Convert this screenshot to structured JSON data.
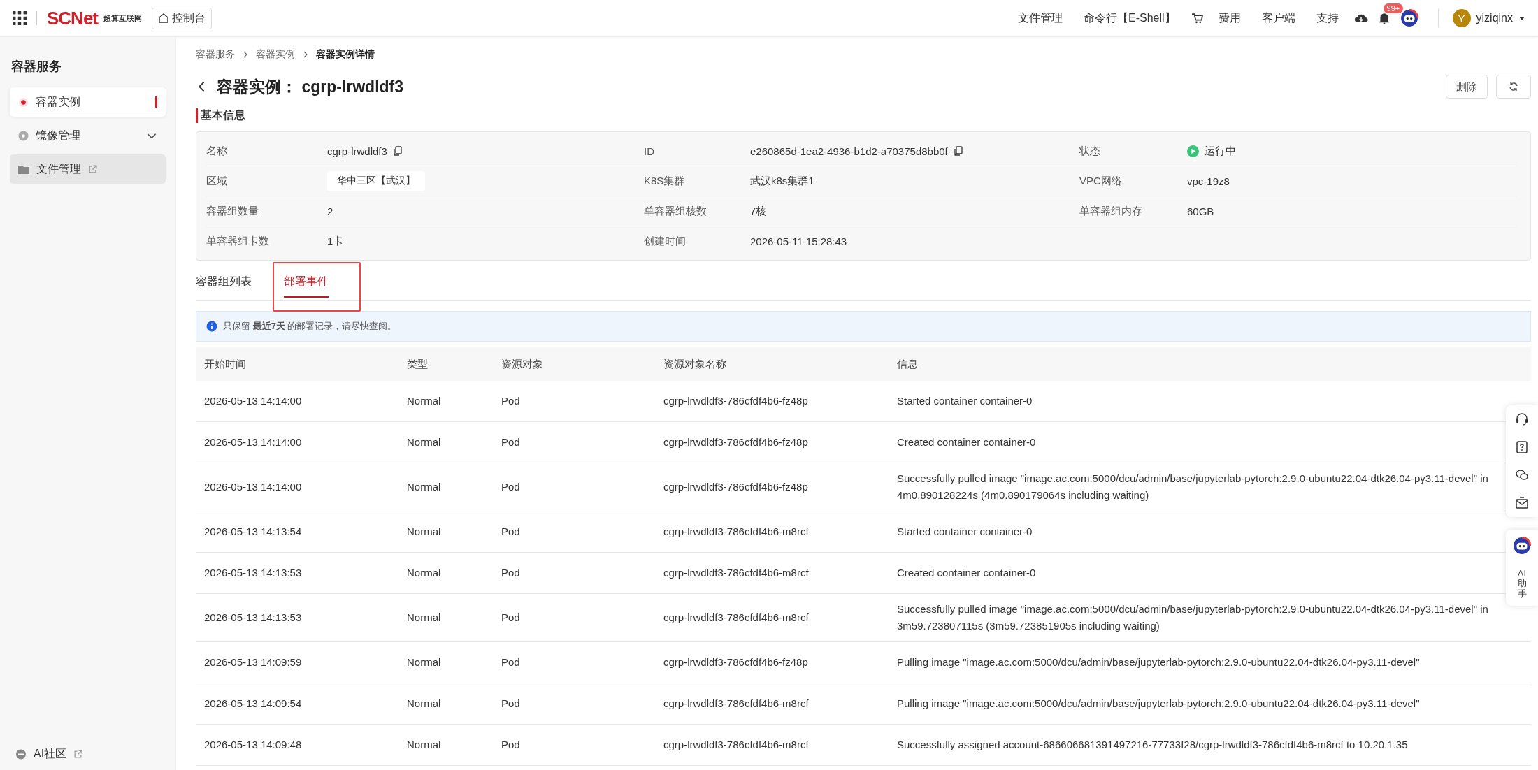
{
  "topbar": {
    "logo": "SCNet",
    "logo_sub": "超算互联网",
    "console": "控制台",
    "links": [
      {
        "kind": "text",
        "label": "文件管理"
      },
      {
        "kind": "text",
        "label": "命令行【E-Shell】"
      },
      {
        "kind": "cart"
      },
      {
        "kind": "text",
        "label": "费用"
      },
      {
        "kind": "text",
        "label": "客户端"
      },
      {
        "kind": "text",
        "label": "支持"
      },
      {
        "kind": "cloud"
      },
      {
        "kind": "bell",
        "badge": "99+"
      },
      {
        "kind": "robot"
      }
    ],
    "user": {
      "initial": "Y",
      "name": "yiziqinx"
    }
  },
  "sidebar": {
    "title": "容器服务",
    "items": [
      {
        "label": "容器实例",
        "selected": true,
        "expandable": false,
        "external": false,
        "hovered": false
      },
      {
        "label": "镜像管理",
        "selected": false,
        "expandable": true,
        "external": false,
        "hovered": false
      },
      {
        "label": "文件管理",
        "selected": false,
        "expandable": false,
        "external": true,
        "hovered": true
      }
    ],
    "footer": {
      "label": "AI社区",
      "external": true
    }
  },
  "breadcrumb": [
    {
      "label": "容器服务",
      "current": false
    },
    {
      "label": "容器实例",
      "current": false
    },
    {
      "label": "容器实例详情",
      "current": true
    }
  ],
  "page": {
    "title_label": "容器实例：",
    "title_value": "cgrp-lrwdldf3",
    "actions": [
      {
        "kind": "text",
        "label": "删除"
      },
      {
        "kind": "refresh"
      }
    ]
  },
  "basic_info": {
    "heading": "基本信息",
    "fields": [
      {
        "label": "名称",
        "value": "cgrp-lrwdldf3",
        "kind": "copy"
      },
      {
        "label": "ID",
        "value": "e260865d-1ea2-4936-b1d2-a70375d8bb0f",
        "kind": "copy"
      },
      {
        "label": "状态",
        "value": "运行中",
        "kind": "status"
      },
      {
        "label": "区域",
        "value": "华中三区【武汉】",
        "kind": "tag"
      },
      {
        "label": "K8S集群",
        "value": "武汉k8s集群1",
        "kind": "text"
      },
      {
        "label": "VPC网络",
        "value": "vpc-19z8",
        "kind": "text"
      },
      {
        "label": "容器组数量",
        "value": "2",
        "kind": "text"
      },
      {
        "label": "单容器组核数",
        "value": "7核",
        "kind": "text"
      },
      {
        "label": "单容器组内存",
        "value": "60GB",
        "kind": "text"
      },
      {
        "label": "单容器组卡数",
        "value": "1卡",
        "kind": "text"
      },
      {
        "label": "创建时间",
        "value": "2026-05-11 15:28:43",
        "kind": "text"
      }
    ]
  },
  "tabs": [
    {
      "label": "容器组列表",
      "selected": false,
      "highlighted": false
    },
    {
      "label": "部署事件",
      "selected": true,
      "highlighted": true
    }
  ],
  "notice": "只保留 **最近7天** 的部署记录，请尽快查阅。",
  "table": {
    "columns": [
      "开始时间",
      "类型",
      "资源对象",
      "资源对象名称",
      "信息"
    ],
    "rows": [
      [
        "2026-05-13 14:14:00",
        "Normal",
        "Pod",
        "cgrp-lrwdldf3-786cfdf4b6-fz48p",
        "Started container container-0"
      ],
      [
        "2026-05-13 14:14:00",
        "Normal",
        "Pod",
        "cgrp-lrwdldf3-786cfdf4b6-fz48p",
        "Created container container-0"
      ],
      [
        "2026-05-13 14:14:00",
        "Normal",
        "Pod",
        "cgrp-lrwdldf3-786cfdf4b6-fz48p",
        "Successfully pulled image \"image.ac.com:5000/dcu/admin/base/jupyterlab-pytorch:2.9.0-ubuntu22.04-dtk26.04-py3.11-devel\" in 4m0.890128224s (4m0.890179064s including waiting)"
      ],
      [
        "2026-05-13 14:13:54",
        "Normal",
        "Pod",
        "cgrp-lrwdldf3-786cfdf4b6-m8rcf",
        "Started container container-0"
      ],
      [
        "2026-05-13 14:13:53",
        "Normal",
        "Pod",
        "cgrp-lrwdldf3-786cfdf4b6-m8rcf",
        "Created container container-0"
      ],
      [
        "2026-05-13 14:13:53",
        "Normal",
        "Pod",
        "cgrp-lrwdldf3-786cfdf4b6-m8rcf",
        "Successfully pulled image \"image.ac.com:5000/dcu/admin/base/jupyterlab-pytorch:2.9.0-ubuntu22.04-dtk26.04-py3.11-devel\" in 3m59.723807115s (3m59.723851905s including waiting)"
      ],
      [
        "2026-05-13 14:09:59",
        "Normal",
        "Pod",
        "cgrp-lrwdldf3-786cfdf4b6-fz48p",
        "Pulling image \"image.ac.com:5000/dcu/admin/base/jupyterlab-pytorch:2.9.0-ubuntu22.04-dtk26.04-py3.11-devel\""
      ],
      [
        "2026-05-13 14:09:54",
        "Normal",
        "Pod",
        "cgrp-lrwdldf3-786cfdf4b6-m8rcf",
        "Pulling image \"image.ac.com:5000/dcu/admin/base/jupyterlab-pytorch:2.9.0-ubuntu22.04-dtk26.04-py3.11-devel\""
      ],
      [
        "2026-05-13 14:09:48",
        "Normal",
        "Pod",
        "cgrp-lrwdldf3-786cfdf4b6-m8rcf",
        "Successfully assigned account-686606681391497216-77733f28/cgrp-lrwdldf3-786cfdf4b6-m8rcf to 10.20.1.35"
      ]
    ]
  },
  "float_panel": {
    "assistant": "AI助手"
  }
}
